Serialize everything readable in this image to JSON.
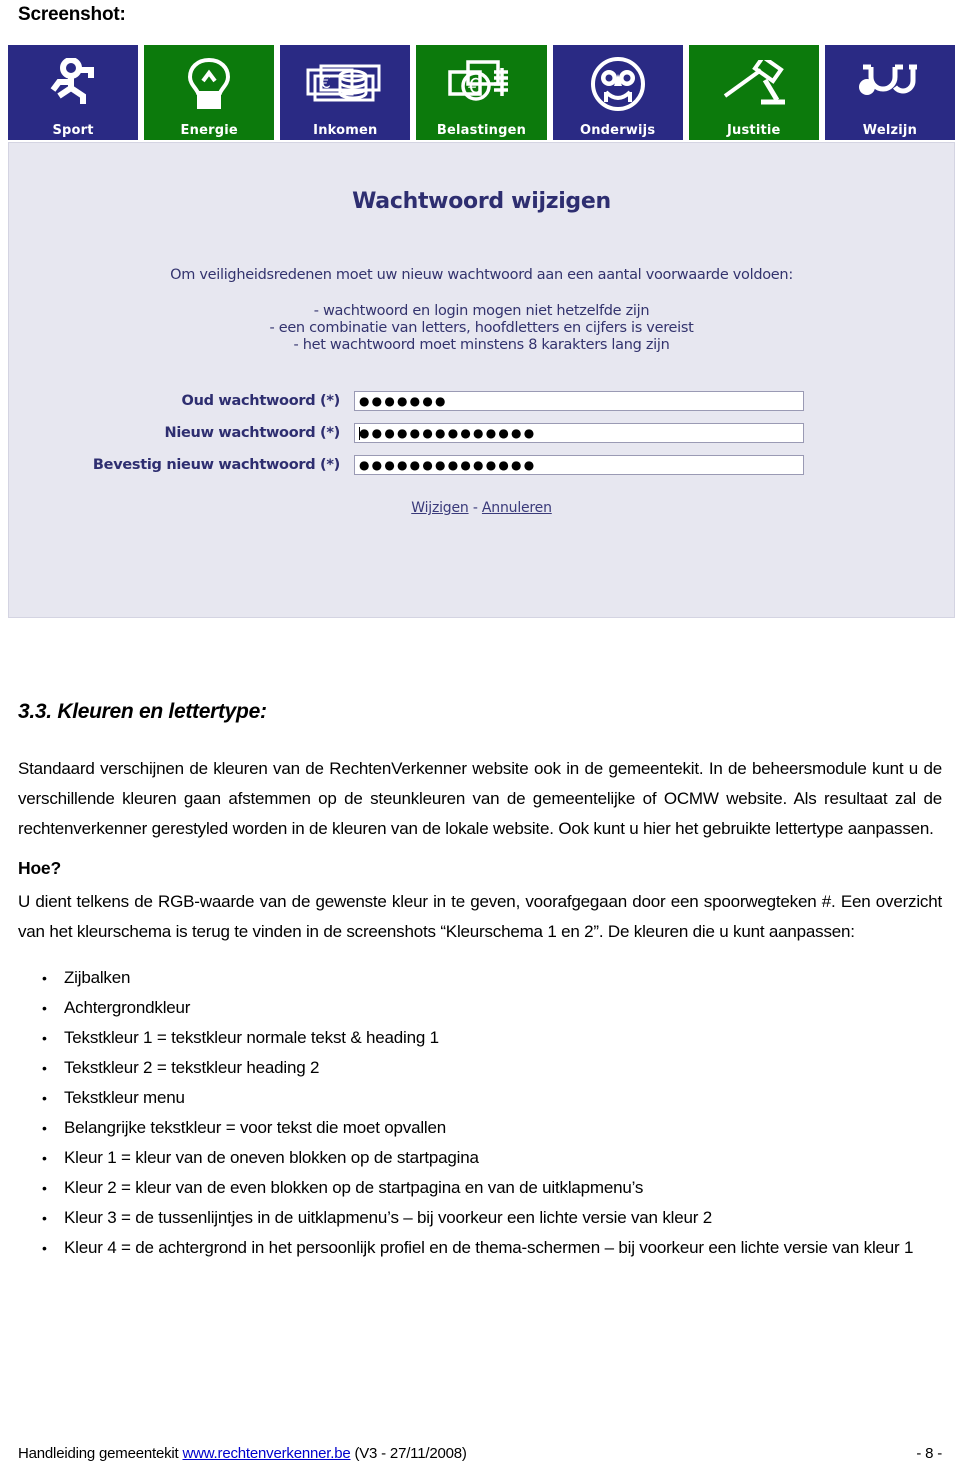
{
  "caption": "Screenshot:",
  "app": {
    "tiles": [
      {
        "label": "Sport",
        "color": "#2a2a84",
        "icon": "running-person-icon"
      },
      {
        "label": "Energie",
        "color": "#0c7a0c",
        "icon": "lightbulb-icon"
      },
      {
        "label": "Inkomen",
        "color": "#2a2a84",
        "icon": "banknotes-coins-icon"
      },
      {
        "label": "Belastingen",
        "color": "#0c7a0c",
        "icon": "euro-documents-icon"
      },
      {
        "label": "Onderwijs",
        "color": "#2a2a84",
        "icon": "owl-icon"
      },
      {
        "label": "Justitie",
        "color": "#0c7a0c",
        "icon": "gavel-icon"
      },
      {
        "label": "Welzijn",
        "color": "#2a2a84",
        "icon": "stethoscope-icon"
      }
    ],
    "title": "Wachtwoord wijzigen",
    "intro": "Om veiligheidsredenen moet uw nieuw wachtwoord aan een aantal voorwaarde voldoen:",
    "rules": [
      "- wachtwoord en login mogen niet hetzelfde zijn",
      "- een combinatie van letters, hoofdletters en cijfers is vereist",
      "- het wachtwoord moet minstens 8 karakters lang zijn"
    ],
    "fields": [
      {
        "label": "Oud wachtwoord (*)",
        "value": "●●●●●●●",
        "focused": false
      },
      {
        "label": "Nieuw wachtwoord (*)",
        "value": "●●●●●●●●●●●●●●",
        "focused": true
      },
      {
        "label": "Bevestig nieuw wachtwoord (*)",
        "value": "●●●●●●●●●●●●●●",
        "focused": false
      }
    ],
    "submit_label": "Wijzigen",
    "separator": " - ",
    "cancel_label": "Annuleren"
  },
  "doc": {
    "heading": "3.3. Kleuren en lettertype:",
    "paragraph1": "Standaard verschijnen de kleuren van de RechtenVerkenner website ook in de gemeentekit. In de beheersmodule kunt u de verschillende kleuren gaan afstemmen op de steunkleuren van de gemeentelijke of OCMW website. Als resultaat zal de rechtenverkenner gerestyled worden in de kleuren van de lokale website. Ook kunt u hier het gebruikte lettertype aanpassen.",
    "subheading": "Hoe?",
    "paragraph2": "U dient telkens de RGB-waarde van de gewenste kleur in te geven, voorafgegaan door een spoorwegteken #. Een overzicht van het kleurschema is terug te vinden in de screenshots “Kleurschema 1 en 2”. De kleuren die u kunt aanpassen:",
    "bullets": [
      "Zijbalken",
      "Achtergrondkleur",
      "Tekstkleur 1 = tekstkleur normale tekst & heading 1",
      "Tekstkleur 2 = tekstkleur heading 2",
      "Tekstkleur menu",
      "Belangrijke tekstkleur = voor tekst die moet opvallen",
      "Kleur 1 = kleur van de oneven blokken op de startpagina",
      "Kleur 2 = kleur van de even blokken op de startpagina en van de uitklapmenu’s",
      "Kleur 3 = de tussenlijntjes in de uitklapmenu’s – bij voorkeur een lichte versie van kleur 2",
      "Kleur 4 = de achtergrond in het persoonlijk profiel en de thema-schermen – bij voorkeur een lichte versie van kleur 1"
    ]
  },
  "footer": {
    "prefix": "Handleiding gemeentekit ",
    "link": "www.rechtenverkenner.be",
    "suffix": " (V3 - 27/11/2008)",
    "page": "- 8 -"
  }
}
